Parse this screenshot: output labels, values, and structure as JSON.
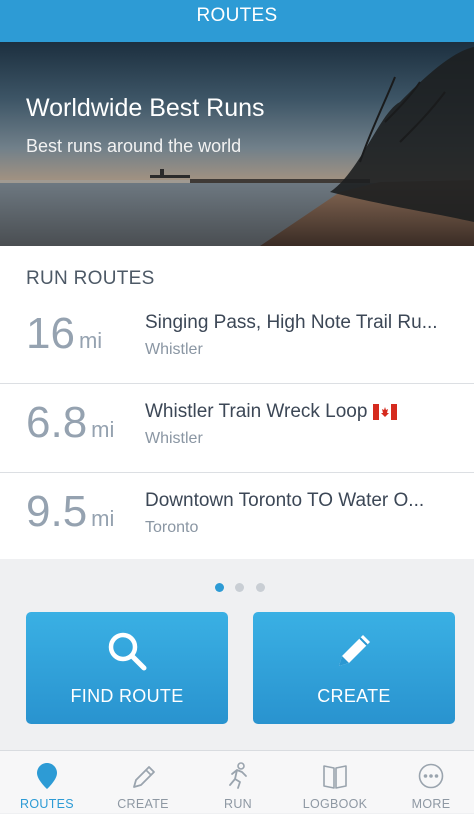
{
  "header": {
    "title": "ROUTES"
  },
  "hero": {
    "title": "Worldwide Best Runs",
    "subtitle": "Best runs around the world"
  },
  "section": {
    "title": "RUN ROUTES"
  },
  "routes": [
    {
      "distance": "16",
      "unit": "mi",
      "name": "Singing Pass, High Note Trail Ru...",
      "location": "Whistler"
    },
    {
      "distance": "6.8",
      "unit": "mi",
      "name": "Whistler Train Wreck Loop",
      "location": "Whistler",
      "flag": "canada-flag-icon"
    },
    {
      "distance": "9.5",
      "unit": "mi",
      "name": "Downtown Toronto TO Water O...",
      "location": "Toronto"
    }
  ],
  "pagination": {
    "total": 3,
    "active": 1
  },
  "actions": {
    "find": {
      "label": "FIND ROUTE",
      "icon": "search-icon"
    },
    "create": {
      "label": "CREATE",
      "icon": "pencil-icon"
    }
  },
  "tabs": [
    {
      "label": "ROUTES",
      "icon": "location-pin-icon",
      "active": true
    },
    {
      "label": "CREATE",
      "icon": "pencil-icon",
      "active": false
    },
    {
      "label": "RUN",
      "icon": "runner-icon",
      "active": false
    },
    {
      "label": "LOGBOOK",
      "icon": "book-icon",
      "active": false
    },
    {
      "label": "MORE",
      "icon": "more-icon",
      "active": false
    }
  ],
  "colors": {
    "accent": "#2d9bd5",
    "inactive": "#8e98a3"
  }
}
